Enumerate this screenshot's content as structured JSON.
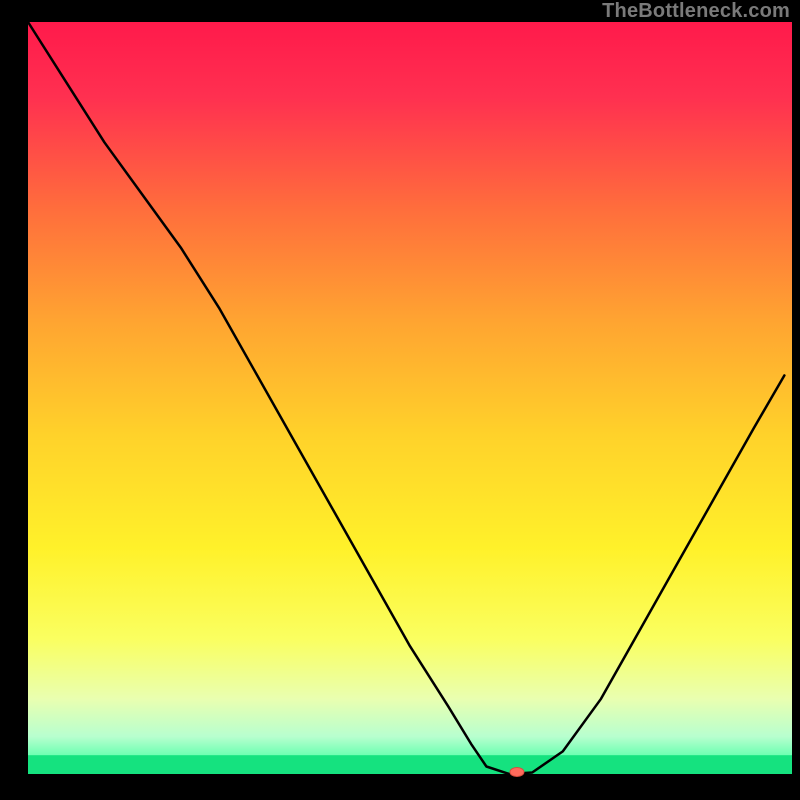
{
  "watermark": "TheBottleneck.com",
  "chart_data": {
    "type": "line",
    "title": "",
    "xlabel": "",
    "ylabel": "",
    "xlim": [
      0,
      100
    ],
    "ylim": [
      0,
      100
    ],
    "grid": false,
    "gradient_stops": [
      {
        "offset": 0.0,
        "color": "#ff1a4b"
      },
      {
        "offset": 0.1,
        "color": "#ff3050"
      },
      {
        "offset": 0.25,
        "color": "#ff6e3c"
      },
      {
        "offset": 0.4,
        "color": "#ffa531"
      },
      {
        "offset": 0.55,
        "color": "#ffd22a"
      },
      {
        "offset": 0.7,
        "color": "#fff12a"
      },
      {
        "offset": 0.82,
        "color": "#faff60"
      },
      {
        "offset": 0.9,
        "color": "#e9ffb0"
      },
      {
        "offset": 0.95,
        "color": "#b8ffcf"
      },
      {
        "offset": 0.975,
        "color": "#6effb2"
      },
      {
        "offset": 1.0,
        "color": "#15e27f"
      }
    ],
    "series": [
      {
        "name": "bottleneck-curve",
        "color": "#000000",
        "x": [
          0,
          5,
          10,
          15,
          20,
          25,
          30,
          35,
          40,
          45,
          50,
          55,
          58,
          60,
          63,
          66,
          70,
          75,
          80,
          85,
          90,
          95,
          99
        ],
        "y": [
          100,
          92,
          84,
          77,
          70,
          62,
          53,
          44,
          35,
          26,
          17,
          9,
          4,
          1,
          0,
          0.2,
          3,
          10,
          19,
          28,
          37,
          46,
          53
        ]
      }
    ],
    "marker": {
      "name": "optimal-point",
      "x": 64,
      "y": 0,
      "color": "#ff6a5c",
      "rx": 7,
      "ry": 4.5
    },
    "green_band": {
      "from_y": 0,
      "to_y": 2.5,
      "color": "#15e27f"
    }
  }
}
